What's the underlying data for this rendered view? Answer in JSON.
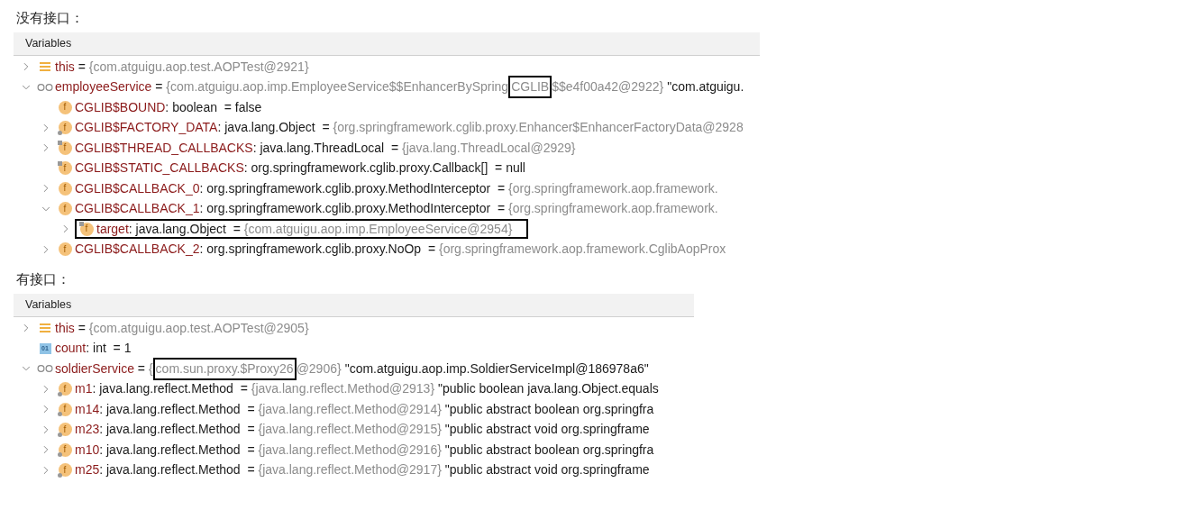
{
  "sections": [
    {
      "heading": "没有接口：",
      "panel": {
        "title": "Variables",
        "rows": [
          {
            "kind": "list",
            "expanded": false,
            "name": "this",
            "type": " =",
            "value": [
              {
                "kind": "reference",
                "text": "{com.atguigu.aop.test.AOPTest@2921}",
                "boxed": false
              }
            ]
          },
          {
            "kind": "watch",
            "expanded": true,
            "name": "employeeService",
            "type": " =",
            "value": [
              {
                "kind": "reference",
                "text": "{com.atguigu.aop.imp.EmployeeService$$EnhancerBySpring",
                "boxed": false
              },
              {
                "kind": "reference",
                "text": "CGLIB",
                "boxed": true
              },
              {
                "kind": "reference",
                "text": "$$e4f00a42@2922}",
                "boxed": false
              }
            ],
            "extra": "\"com.atguigu.",
            "children": [
              {
                "kind": "field",
                "icon_label": "f",
                "name": "CGLIB$BOUND",
                "type": ": boolean  =",
                "value": [
                  {
                    "kind": "literal",
                    "text": "false",
                    "boxed": false
                  }
                ]
              },
              {
                "kind": "field_final",
                "icon_label": "f",
                "expanded": false,
                "name": "CGLIB$FACTORY_DATA",
                "type": ": java.lang.Object  =",
                "value": [
                  {
                    "kind": "reference",
                    "text": "{org.springframework.cglib.proxy.Enhancer$EnhancerFactoryData@2928",
                    "boxed": false
                  }
                ]
              },
              {
                "kind": "field_static",
                "icon_label": "f",
                "expanded": false,
                "name": "CGLIB$THREAD_CALLBACKS",
                "type": ": java.lang.ThreadLocal  =",
                "value": [
                  {
                    "kind": "reference",
                    "text": "{java.lang.ThreadLocal@2929}",
                    "boxed": false
                  }
                ]
              },
              {
                "kind": "field_static",
                "icon_label": "f",
                "name": "CGLIB$STATIC_CALLBACKS",
                "type": ": org.springframework.cglib.proxy.Callback[]  =",
                "value": [
                  {
                    "kind": "literal",
                    "text": "null",
                    "boxed": false
                  }
                ]
              },
              {
                "kind": "field",
                "icon_label": "f",
                "expanded": false,
                "name": "CGLIB$CALLBACK_0",
                "type": ": org.springframework.cglib.proxy.MethodInterceptor  =",
                "value": [
                  {
                    "kind": "reference",
                    "text": "{org.springframework.aop.framework.",
                    "boxed": false
                  }
                ]
              },
              {
                "kind": "field",
                "icon_label": "f",
                "expanded": true,
                "name": "CGLIB$CALLBACK_1",
                "type": ": org.springframework.cglib.proxy.MethodInterceptor  =",
                "value": [
                  {
                    "kind": "reference",
                    "text": "{org.springframework.aop.framework.",
                    "boxed": false
                  }
                ],
                "children": [
                  {
                    "kind": "field_static",
                    "icon_label": "f",
                    "expanded": false,
                    "boxed": true,
                    "name": "target",
                    "type": ": java.lang.Object  =",
                    "value": [
                      {
                        "kind": "reference",
                        "text": "{com.atguigu.aop.imp.EmployeeService@2954}",
                        "boxed": false
                      }
                    ]
                  }
                ]
              },
              {
                "kind": "field",
                "icon_label": "f",
                "expanded": false,
                "name": "CGLIB$CALLBACK_2",
                "type": ": org.springframework.cglib.proxy.NoOp  =",
                "value": [
                  {
                    "kind": "reference",
                    "text": "{org.springframework.aop.framework.CglibAopProx",
                    "boxed": false
                  }
                ]
              }
            ]
          }
        ]
      }
    },
    {
      "heading": "有接口：",
      "panel": {
        "title": "Variables",
        "rows": [
          {
            "kind": "list",
            "expanded": false,
            "name": "this",
            "type": " =",
            "value": [
              {
                "kind": "reference",
                "text": "{com.atguigu.aop.test.AOPTest@2905}",
                "boxed": false
              }
            ]
          },
          {
            "kind": "primitive",
            "icon_label": "01",
            "name": "count",
            "type": ": int  =",
            "value": [
              {
                "kind": "literal",
                "text": "1",
                "boxed": false
              }
            ]
          },
          {
            "kind": "watch",
            "expanded": true,
            "name": "soldierService",
            "type": " =",
            "value": [
              {
                "kind": "reference",
                "text": "{",
                "boxed": false
              },
              {
                "kind": "reference",
                "text": "com.sun.proxy.$Proxy26",
                "boxed": true
              },
              {
                "kind": "reference",
                "text": "@2906}",
                "boxed": false
              }
            ],
            "extra": "\"com.atguigu.aop.imp.SoldierServiceImpl@186978a6\"",
            "children": [
              {
                "kind": "field_final",
                "icon_label": "f",
                "expanded": false,
                "name": "m1",
                "type": ": java.lang.reflect.Method  =",
                "value": [
                  {
                    "kind": "reference",
                    "text": "{java.lang.reflect.Method@2913}",
                    "boxed": false
                  }
                ],
                "extra": "\"public boolean java.lang.Object.equals"
              },
              {
                "kind": "field_final",
                "icon_label": "f",
                "expanded": false,
                "name": "m14",
                "type": ": java.lang.reflect.Method  =",
                "value": [
                  {
                    "kind": "reference",
                    "text": "{java.lang.reflect.Method@2914}",
                    "boxed": false
                  }
                ],
                "extra": "\"public abstract boolean org.springfra"
              },
              {
                "kind": "field_final",
                "icon_label": "f",
                "expanded": false,
                "name": "m23",
                "type": ": java.lang.reflect.Method  =",
                "value": [
                  {
                    "kind": "reference",
                    "text": "{java.lang.reflect.Method@2915}",
                    "boxed": false
                  }
                ],
                "extra": "\"public abstract void org.springframe"
              },
              {
                "kind": "field_final",
                "icon_label": "f",
                "expanded": false,
                "name": "m10",
                "type": ": java.lang.reflect.Method  =",
                "value": [
                  {
                    "kind": "reference",
                    "text": "{java.lang.reflect.Method@2916}",
                    "boxed": false
                  }
                ],
                "extra": "\"public abstract boolean org.springfra"
              },
              {
                "kind": "field_final",
                "icon_label": "f",
                "expanded": false,
                "name": "m25",
                "type": ": java.lang.reflect.Method  =",
                "value": [
                  {
                    "kind": "reference",
                    "text": "{java.lang.reflect.Method@2917}",
                    "boxed": false
                  }
                ],
                "extra": "\"public abstract void org.springframe"
              }
            ]
          }
        ]
      }
    }
  ]
}
